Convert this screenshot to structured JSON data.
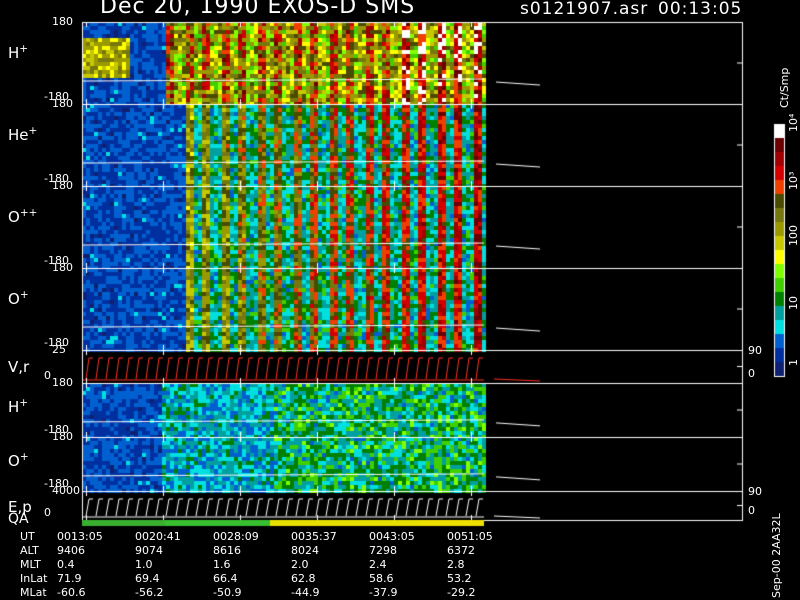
{
  "header": {
    "title": "Dec 20, 1990   EXOS-D SMS",
    "file": "s0121907.asr",
    "time": "00:13:05"
  },
  "footer_label": "Sep-00 2AA32L",
  "colorbar": {
    "title": "Ct/Smp",
    "ticks": [
      "10⁴",
      "10³",
      "100",
      "10",
      "1"
    ],
    "colors": [
      "#ffffff",
      "#6b0000",
      "#a00000",
      "#d40000",
      "#f04000",
      "#4a4a00",
      "#777710",
      "#9a9a00",
      "#c8c800",
      "#ffff00",
      "#80ff00",
      "#40d000",
      "#008000",
      "#00a0a0",
      "#00e0e0",
      "#0060d0",
      "#0030a0",
      "#102070"
    ]
  },
  "chart_data": {
    "type": "heatmap",
    "x_ticks": [
      "0013:05",
      "0020:41",
      "0028:09",
      "0035:37",
      "0043:05",
      "0051:05"
    ],
    "panels": [
      {
        "label": "H",
        "sup": "+",
        "ymax": "180",
        "ymin": "-180",
        "kind": "spectro",
        "intensity": "high"
      },
      {
        "label": "He",
        "sup": "+",
        "ymax": "180",
        "ymin": "-180",
        "kind": "spectro",
        "intensity": "mid"
      },
      {
        "label": "O",
        "sup": "++",
        "ymax": "180",
        "ymin": "-180",
        "kind": "spectro",
        "intensity": "mid"
      },
      {
        "label": "O",
        "sup": "+",
        "ymax": "180",
        "ymin": "-180",
        "kind": "spectro",
        "intensity": "mid"
      },
      {
        "label": "V,r",
        "sup": "",
        "ymax": "25",
        "ymin": "0",
        "right_top": "90",
        "right_bottom": "0",
        "kind": "line",
        "intensity": "red"
      },
      {
        "label": "H",
        "sup": "+",
        "ymax": "180",
        "ymin": "-180",
        "kind": "spectro",
        "intensity": "low"
      },
      {
        "label": "O",
        "sup": "+",
        "ymax": "180",
        "ymin": "-180",
        "kind": "spectro",
        "intensity": "low"
      },
      {
        "label": "E,p",
        "sup": "",
        "ymax": "4000",
        "ymin": "0",
        "right_top": "90",
        "right_bottom": "0",
        "kind": "line",
        "intensity": "white"
      }
    ],
    "qa_label": "QA",
    "orbit_table": {
      "rows": [
        {
          "name": "UT",
          "values": [
            "0013:05",
            "0020:41",
            "0028:09",
            "0035:37",
            "0043:05",
            "0051:05"
          ]
        },
        {
          "name": "ALT",
          "values": [
            "9406",
            "9074",
            "8616",
            "8024",
            "7298",
            "6372"
          ]
        },
        {
          "name": "MLT",
          "values": [
            "0.4",
            "1.0",
            "1.6",
            "2.0",
            "2.4",
            "2.8"
          ]
        },
        {
          "name": "InLat",
          "values": [
            "71.9",
            "69.4",
            "66.4",
            "62.8",
            "58.6",
            "53.2"
          ]
        },
        {
          "name": "MLat",
          "values": [
            "-60.6",
            "-56.2",
            "-50.9",
            "-44.9",
            "-37.9",
            "-29.2"
          ]
        }
      ]
    }
  }
}
